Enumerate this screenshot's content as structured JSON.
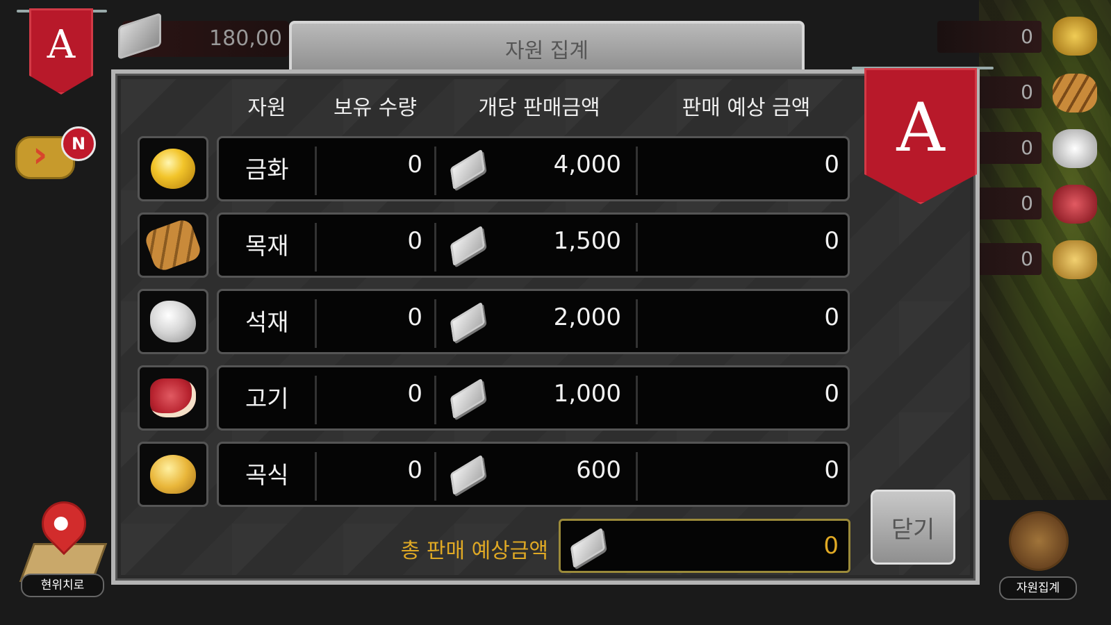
{
  "hud": {
    "guild_letter": "A",
    "silver_amount": "180,00",
    "chat_badge": "N",
    "location_label": "현위치로",
    "resource_summary_label": "자원집계",
    "side_counters": [
      "0",
      "0",
      "0",
      "0",
      "0"
    ]
  },
  "dialog": {
    "title": "자원 집계",
    "banner_letter": "A",
    "columns": [
      "자원",
      "보유 수량",
      "개당 판매금액",
      "판매 예상 금액"
    ],
    "rows": [
      {
        "icon": "gold-coins-icon",
        "name": "금화",
        "owned": "0",
        "unit_price": "4,000",
        "expected": "0"
      },
      {
        "icon": "wood-logs-icon",
        "name": "목재",
        "owned": "0",
        "unit_price": "1,500",
        "expected": "0"
      },
      {
        "icon": "stone-icon",
        "name": "석재",
        "owned": "0",
        "unit_price": "2,000",
        "expected": "0"
      },
      {
        "icon": "meat-icon",
        "name": "고기",
        "owned": "0",
        "unit_price": "1,000",
        "expected": "0"
      },
      {
        "icon": "grain-icon",
        "name": "곡식",
        "owned": "0",
        "unit_price": "600",
        "expected": "0"
      }
    ],
    "total_label": "총 판매 예상금액",
    "total_value": "0",
    "close_label": "닫기"
  },
  "colors": {
    "banner_red": "#b8192a",
    "gold_text": "#e0a924",
    "panel_frame": "#b4b4b4"
  }
}
